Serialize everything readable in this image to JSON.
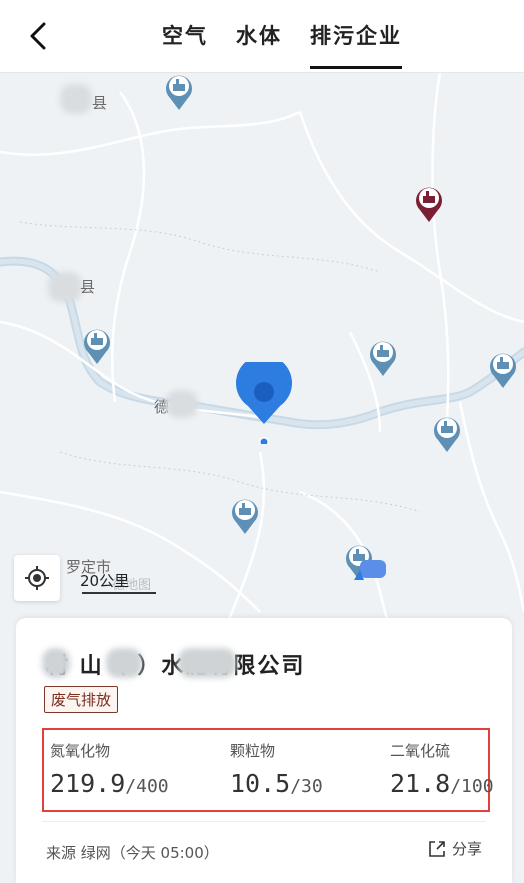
{
  "header": {
    "tabs": [
      {
        "label": "空气"
      },
      {
        "label": "水体"
      },
      {
        "label": "排污企业"
      }
    ],
    "active_tab": "排污企业"
  },
  "map": {
    "places": [
      {
        "name": "县"
      },
      {
        "name": "县"
      },
      {
        "name": "德"
      },
      {
        "name": "罗定市"
      }
    ],
    "scale_label": "20公里",
    "watermark": "德地图"
  },
  "card": {
    "company_name": "材  山（   ）水泥有限公司",
    "tag": "废气排放",
    "metrics": [
      {
        "label": "氮氧化物",
        "value": "219.9",
        "limit": "/400"
      },
      {
        "label": "颗粒物",
        "value": "10.5",
        "limit": "/30"
      },
      {
        "label": "二氧化硫",
        "value": "21.8",
        "limit": "/100"
      }
    ],
    "source": "来源 绿网（今天 05:00）",
    "share_label": "分享"
  },
  "colors": {
    "pin_blue": "#5e8fb5",
    "pin_dark_red": "#7b1f35",
    "selected_blue": "#2d7de0",
    "highlight_red": "#e0413a"
  }
}
